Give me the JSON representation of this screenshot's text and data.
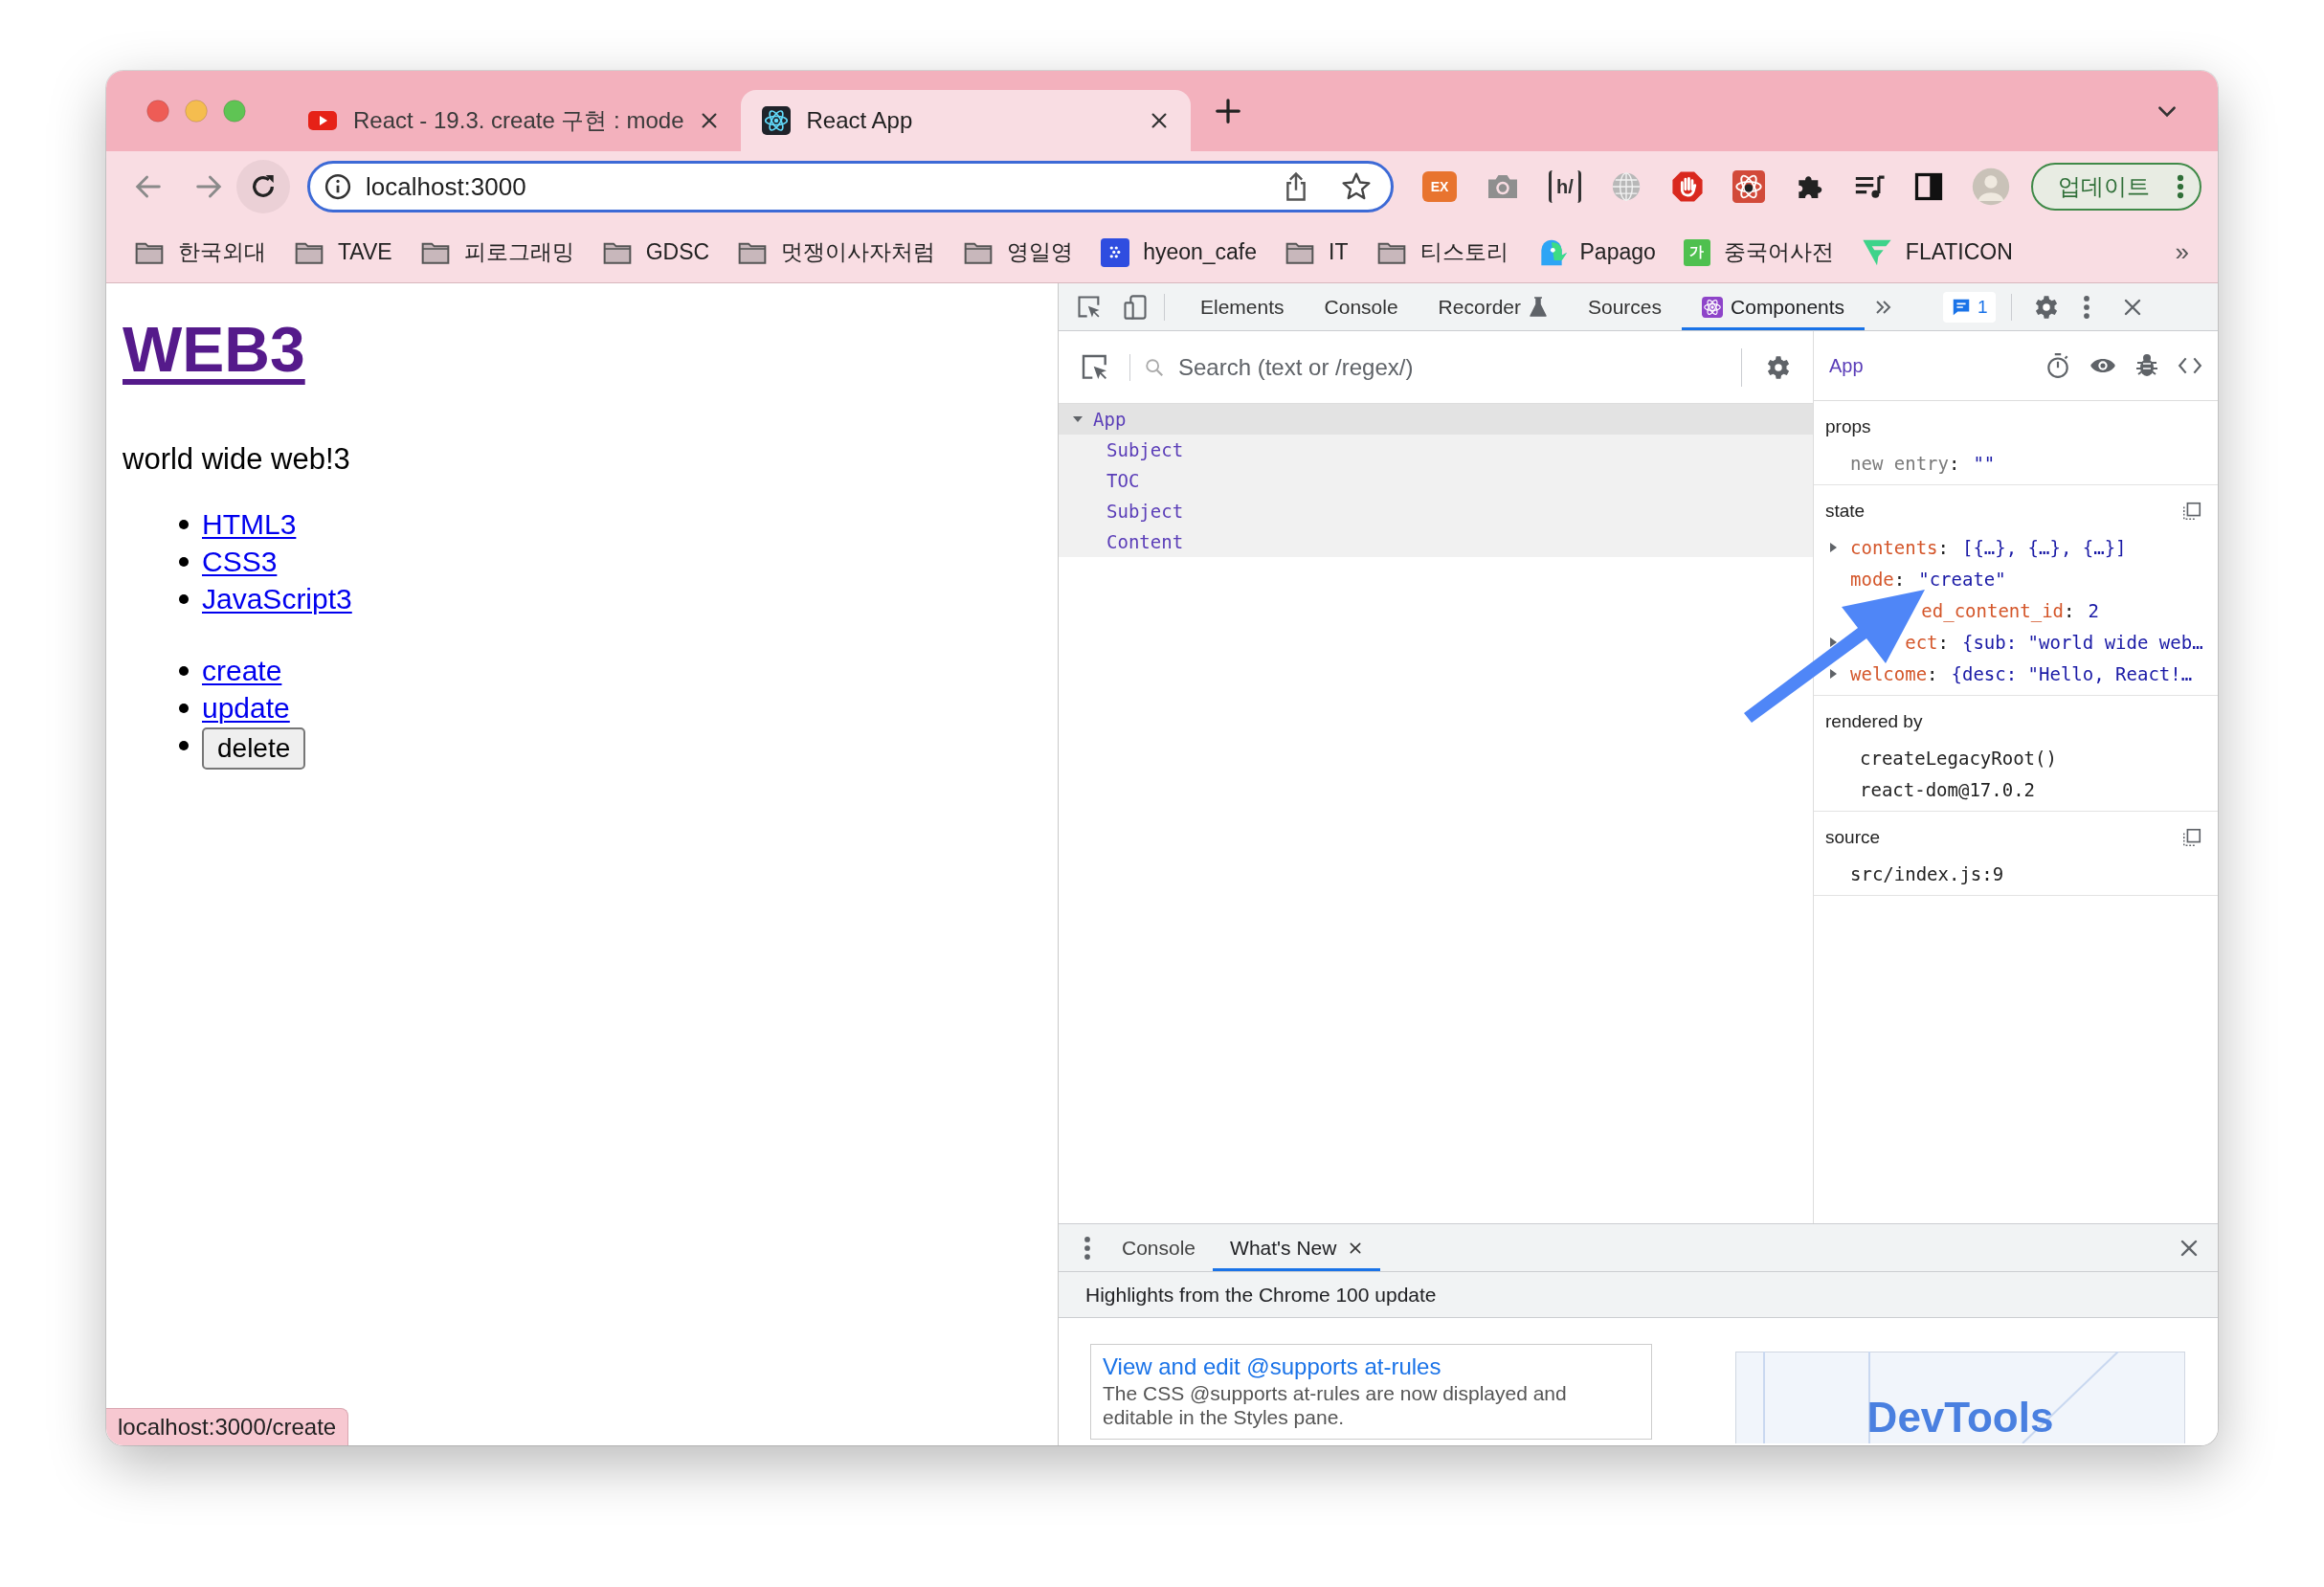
{
  "tabs": [
    {
      "title": "React - 19.3. create 구현 : mode",
      "selected": false,
      "kind": "video"
    },
    {
      "title": "React App",
      "selected": true,
      "kind": "react"
    }
  ],
  "address_bar": {
    "value": "localhost:3000"
  },
  "extensions": [
    {
      "kind": "ex",
      "label": "EX"
    },
    {
      "kind": "camera"
    },
    {
      "kind": "hbracket",
      "label": "h/"
    },
    {
      "kind": "globe"
    },
    {
      "kind": "stop"
    },
    {
      "kind": "reactbug"
    },
    {
      "kind": "puzzle"
    },
    {
      "kind": "playlist"
    },
    {
      "kind": "sidepanel"
    },
    {
      "kind": "avatar"
    }
  ],
  "update_button": {
    "label": "업데이트"
  },
  "bookmarks": [
    {
      "label": "한국외대",
      "kind": "folder"
    },
    {
      "label": "TAVE",
      "kind": "folder"
    },
    {
      "label": "피로그래밍",
      "kind": "folder"
    },
    {
      "label": "GDSC",
      "kind": "folder"
    },
    {
      "label": "멋쟁이사자처럼",
      "kind": "folder"
    },
    {
      "label": "영일영",
      "kind": "folder"
    },
    {
      "label": "hyeon_cafe",
      "kind": "cafe"
    },
    {
      "label": "IT",
      "kind": "folder"
    },
    {
      "label": "티스토리",
      "kind": "folder"
    },
    {
      "label": "Papago",
      "kind": "papago"
    },
    {
      "label": "중국어사전",
      "kind": "dict",
      "badge": "가"
    },
    {
      "label": "FLATICON",
      "kind": "flaticon"
    }
  ],
  "bookmarks_overflow": "»",
  "page": {
    "title": "WEB3",
    "subtitle": "world wide web!3",
    "toc": [
      {
        "label": "HTML3"
      },
      {
        "label": "CSS3"
      },
      {
        "label": "JavaScript3"
      }
    ],
    "controls": [
      {
        "label": "create",
        "kind": "link"
      },
      {
        "label": "update",
        "kind": "link"
      },
      {
        "label": "delete",
        "kind": "button"
      }
    ]
  },
  "status_bubble": "localhost:3000/create",
  "devtools": {
    "tabs": [
      {
        "label": "Elements",
        "selected": false,
        "kind": "plain"
      },
      {
        "label": "Console",
        "selected": false,
        "kind": "plain"
      },
      {
        "label": "Recorder",
        "selected": false,
        "kind": "experiment"
      },
      {
        "label": "Sources",
        "selected": false,
        "kind": "plain"
      },
      {
        "label": "Components",
        "selected": true,
        "kind": "react"
      }
    ],
    "issues": "1"
  },
  "components": {
    "search": {
      "placeholder": "Search (text or /regex/)"
    },
    "tree": [
      {
        "name": "App",
        "selected": true,
        "expanded": true,
        "children": [
          {
            "name": "Subject",
            "selected": false
          },
          {
            "name": "TOC",
            "selected": false
          },
          {
            "name": "Subject",
            "selected": false
          },
          {
            "name": "Content",
            "selected": false
          }
        ]
      }
    ]
  },
  "inspector": {
    "component": "App",
    "sections": [
      {
        "title": "props",
        "copy": false,
        "entries": [
          {
            "kind": "new",
            "key": "new entry:",
            "value": "\"\"",
            "expandable": false
          }
        ]
      },
      {
        "title": "state",
        "copy": true,
        "entries": [
          {
            "kind": "field",
            "key": "contents:",
            "value": "[{…}, {…}, {…}]",
            "expandable": true
          },
          {
            "kind": "field",
            "key": "mode:",
            "value": "\"create\"",
            "expandable": false
          },
          {
            "kind": "field",
            "key": "ed_content_id:",
            "value": "2",
            "expandable": false
          },
          {
            "kind": "field",
            "key": "ect:",
            "value": "{sub: \"world wide web…",
            "expandable": true
          },
          {
            "kind": "field",
            "key": "welcome:",
            "value": "{desc: \"Hello, React!…",
            "expandable": true
          }
        ]
      },
      {
        "title": "rendered by",
        "copy": false,
        "entries": [
          {
            "kind": "text",
            "value": "createLegacyRoot()"
          },
          {
            "kind": "text",
            "value": "react-dom@17.0.2"
          }
        ]
      },
      {
        "title": "source",
        "copy": true,
        "entries": [
          {
            "kind": "source",
            "value": "src/index.js:9"
          }
        ]
      }
    ]
  },
  "drawer": {
    "tabs": [
      {
        "label": "Console",
        "selected": false,
        "closable": false
      },
      {
        "label": "What's New",
        "selected": true,
        "closable": true
      }
    ],
    "heading": "Highlights from the Chrome 100 update",
    "card": {
      "title": "View and edit @supports at-rules",
      "body": "The CSS @supports at-rules are now displayed and editable in the Styles pane."
    },
    "promo": "DevTools"
  }
}
